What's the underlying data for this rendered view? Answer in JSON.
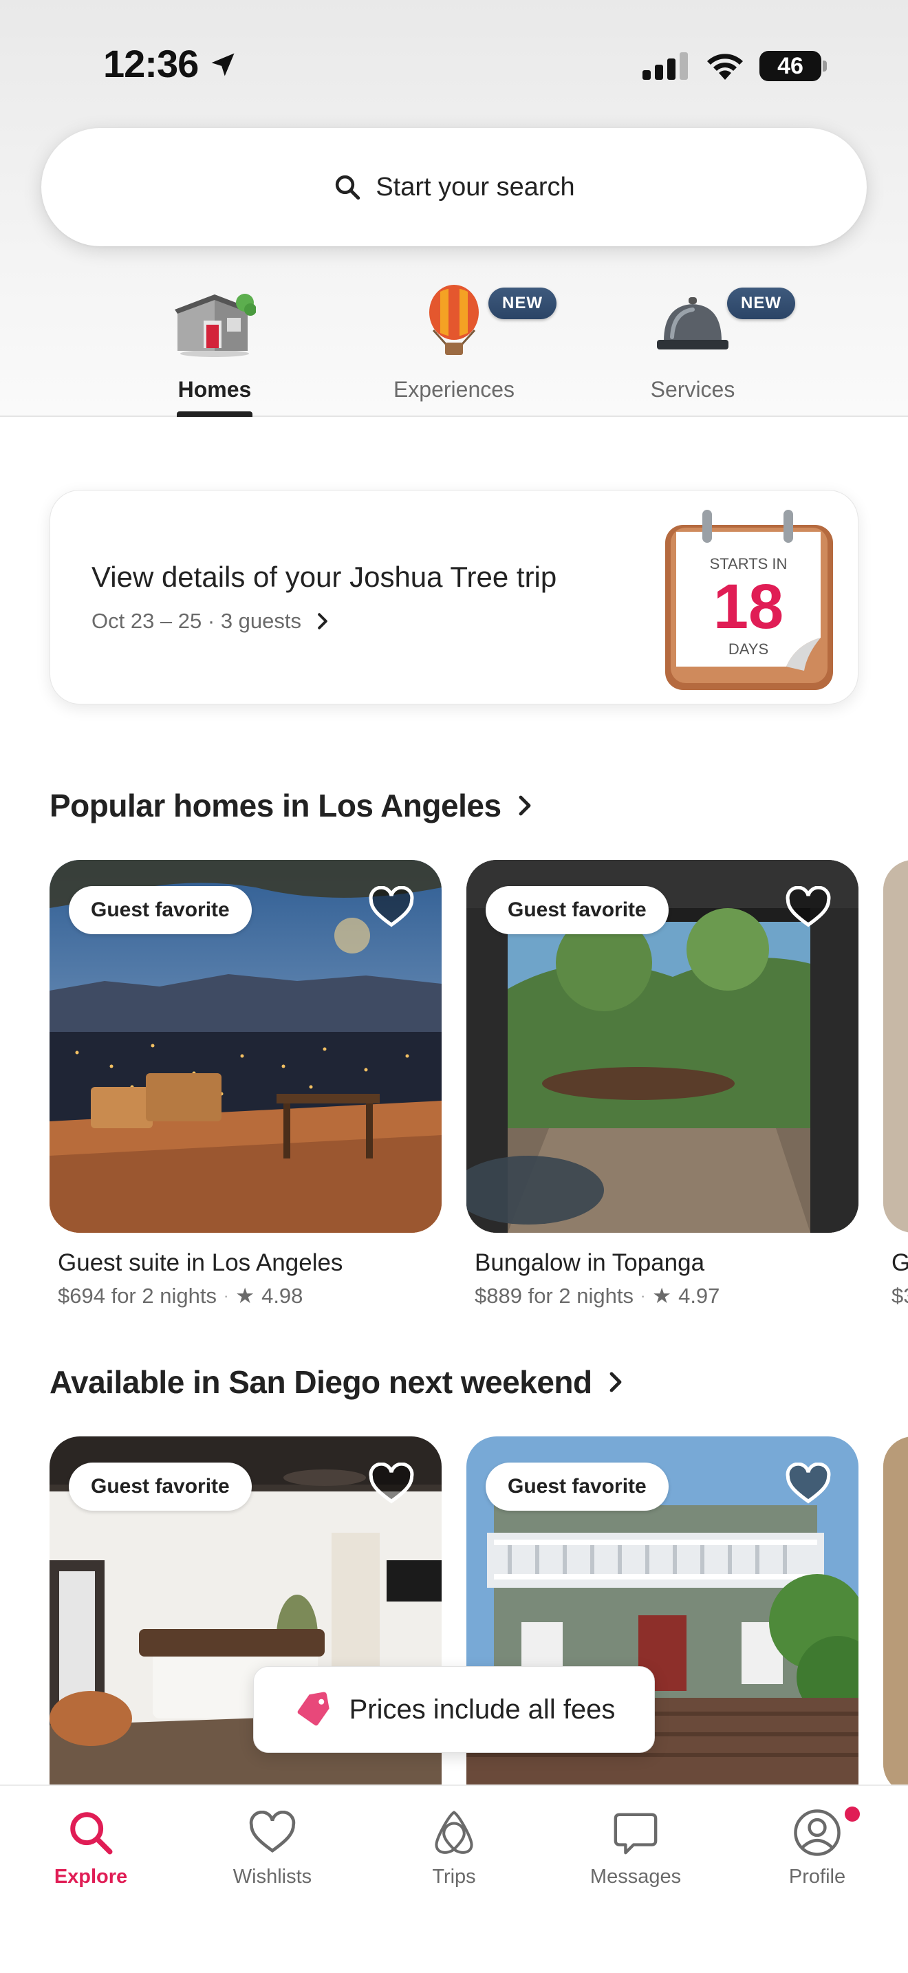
{
  "status_bar": {
    "time": "12:36",
    "battery": "46"
  },
  "search": {
    "label": "Start your search"
  },
  "categories": [
    {
      "label": "Homes",
      "active": true
    },
    {
      "label": "Experiences",
      "badge": "NEW"
    },
    {
      "label": "Services",
      "badge": "NEW"
    }
  ],
  "trip": {
    "title": "View details of your Joshua Tree trip",
    "details": "Oct 23 – 25 · 3 guests",
    "calendar_top": "STARTS IN",
    "calendar_number": "18",
    "calendar_bottom": "DAYS"
  },
  "sections": [
    {
      "title": "Popular homes in Los Angeles",
      "listings": [
        {
          "badge": "Guest favorite",
          "title": "Guest suite in Los Angeles",
          "price": "$694 for 2 nights",
          "rating": "4.98"
        },
        {
          "badge": "Guest favorite",
          "title": "Bungalow in Topanga",
          "price": "$889 for 2 nights",
          "rating": "4.97"
        },
        {
          "title": "G",
          "price": "$3"
        }
      ]
    },
    {
      "title": "Available in San Diego next weekend",
      "listings": [
        {
          "badge": "Guest favorite"
        },
        {
          "badge": "Guest favorite"
        }
      ]
    }
  ],
  "toast": {
    "label": "Prices include all fees"
  },
  "nav": [
    {
      "label": "Explore",
      "icon": "search-icon",
      "active": true
    },
    {
      "label": "Wishlists",
      "icon": "heart-icon"
    },
    {
      "label": "Trips",
      "icon": "airbnb-logo-icon"
    },
    {
      "label": "Messages",
      "icon": "message-icon"
    },
    {
      "label": "Profile",
      "icon": "profile-icon",
      "notification": true
    }
  ],
  "colors": {
    "accent": "#e01d55",
    "badge_blue": "#2f4a6e",
    "text": "#222222",
    "muted": "#6a6a6a"
  }
}
